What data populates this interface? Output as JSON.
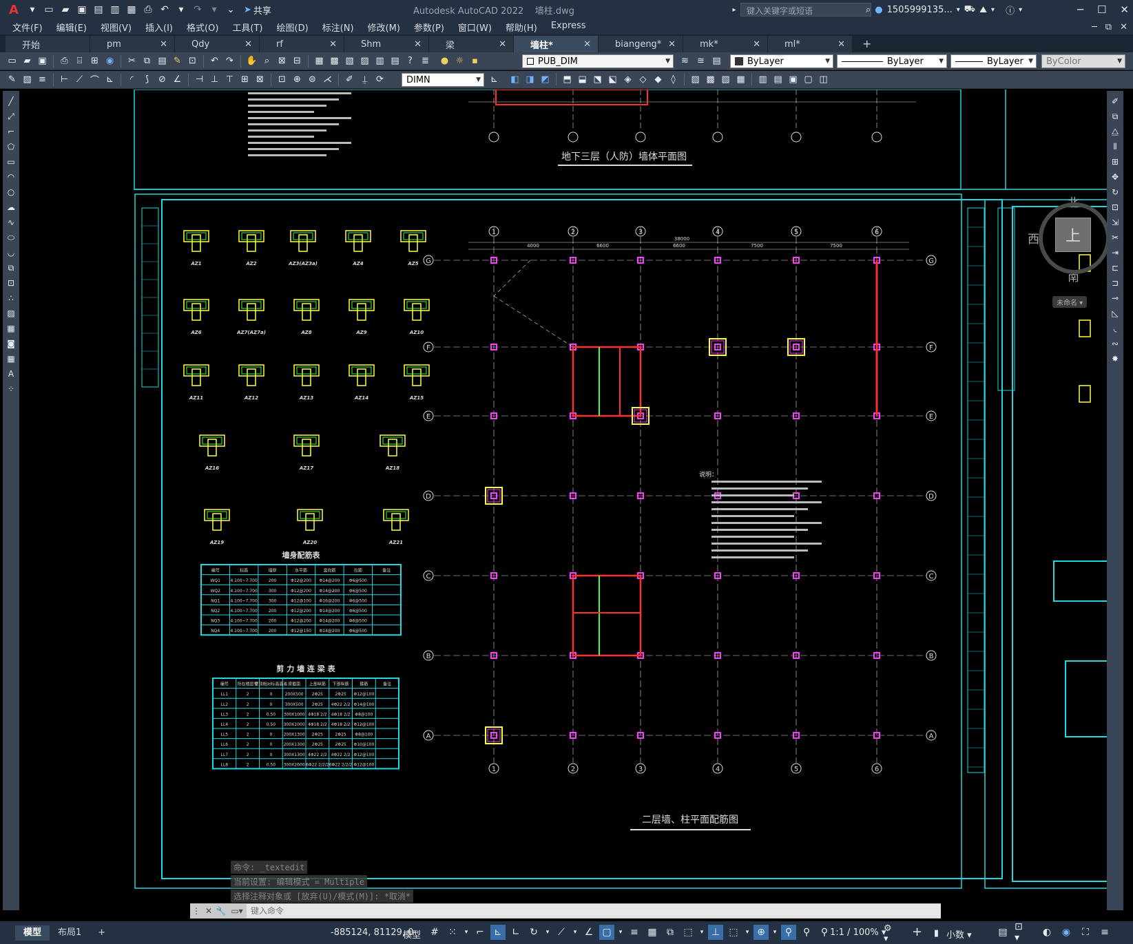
{
  "app": {
    "title": "Autodesk AutoCAD 2022",
    "file_name": "墙柱.dwg",
    "logo": "A",
    "share_label": "共享",
    "search_placeholder": "键入关键字或短语",
    "user_name": "1505999135...",
    "window_controls": [
      "minimize-icon",
      "restore-icon",
      "close-icon"
    ]
  },
  "menu": {
    "items": [
      "文件(F)",
      "编辑(E)",
      "视图(V)",
      "插入(I)",
      "格式(O)",
      "工具(T)",
      "绘图(D)",
      "标注(N)",
      "修改(M)",
      "参数(P)",
      "窗口(W)",
      "帮助(H)",
      "Express"
    ]
  },
  "tabs": {
    "items": [
      {
        "label": "开始",
        "active": false
      },
      {
        "label": "pm",
        "active": false
      },
      {
        "label": "Qdy",
        "active": false
      },
      {
        "label": "rf",
        "active": false
      },
      {
        "label": "Shm",
        "active": false
      },
      {
        "label": "梁",
        "active": false
      },
      {
        "label": "墙柱*",
        "active": true
      },
      {
        "label": "biangeng*",
        "active": false
      },
      {
        "label": "mk*",
        "active": false
      },
      {
        "label": "ml*",
        "active": false
      }
    ],
    "add_label": "+"
  },
  "toolbar": {
    "layer_value": "PUB_DIM",
    "color_value": "ByLayer",
    "linetype_value": "ByLayer",
    "lineweight_value": "ByLayer",
    "plotstyle_value": "ByColor",
    "dimstyle_value": "DIMN"
  },
  "viewcube": {
    "north": "北",
    "south": "南",
    "east": "东",
    "west": "西",
    "top": "上",
    "ucs": "未命名"
  },
  "drawing": {
    "title_top": "地下三层（人防）墙体平面图",
    "title_main": "二层墙、柱平面配筋图",
    "table1_title": "墙身配筋表",
    "table2_title": "剪 力 墙 连 梁 表",
    "notes_title": "说明：",
    "grid_cols": [
      "1",
      "2",
      "3",
      "4",
      "5",
      "6"
    ],
    "grid_rows": [
      "G",
      "F",
      "E",
      "D",
      "C",
      "B",
      "A"
    ],
    "dims_top": [
      "4000",
      "6600",
      "6600",
      "7500",
      "7500",
      "7500"
    ],
    "dims_total": "38000",
    "wall_table": {
      "headers": [
        "编号",
        "标高",
        "墙厚",
        "水平筋",
        "竖向筋",
        "拉筋",
        "备注"
      ],
      "rows": [
        [
          "WQ1",
          "4.100~7.700",
          "200",
          "Φ12@200",
          "Φ14@200",
          "Φ6@500",
          ""
        ],
        [
          "WQ2",
          "4.100~7.700",
          "300",
          "Φ12@200",
          "Φ14@200",
          "Φ6@500",
          ""
        ],
        [
          "NQ1",
          "4.100~7.700",
          "300",
          "Φ12@100",
          "Φ16@200",
          "Φ6@500",
          ""
        ],
        [
          "NQ2",
          "4.100~7.700",
          "200",
          "Φ12@200",
          "Φ14@200",
          "Φ6@500",
          ""
        ],
        [
          "NQ3",
          "4.100~7.700",
          "200",
          "Φ12@200",
          "Φ14@200",
          "Φ6@500",
          ""
        ],
        [
          "NQ4",
          "4.100~7.700",
          "200",
          "Φ12@150",
          "Φ14@200",
          "Φ6@500",
          ""
        ]
      ]
    },
    "beam_table": {
      "headers": [
        "编号",
        "所在楼层号",
        "梁顶相对标高高差",
        "梁截面",
        "上部纵筋",
        "下部纵筋",
        "箍筋",
        "备注"
      ],
      "rows": [
        [
          "LL1",
          "2",
          "0",
          "200X500",
          "2Φ25",
          "2Φ25",
          "Φ12@100",
          ""
        ],
        [
          "LL2",
          "2",
          "0",
          "300X500",
          "2Φ25",
          "4Φ22 2/2",
          "Φ14@100",
          ""
        ],
        [
          "LL3",
          "2",
          "0.50",
          "300X1000",
          "4Φ18 2/2",
          "4Φ18 2/2",
          "Φ8@100",
          ""
        ],
        [
          "LL4",
          "2",
          "0.50",
          "300X1000",
          "4Φ18 2/2",
          "4Φ18 2/2",
          "Φ12@100",
          ""
        ],
        [
          "LL5",
          "2",
          "0",
          "200X1300",
          "2Φ25",
          "2Φ25",
          "Φ8@100",
          ""
        ],
        [
          "LL6",
          "2",
          "0",
          "200X1300",
          "2Φ25",
          "2Φ25",
          "Φ10@100",
          ""
        ],
        [
          "LL7",
          "2",
          "0",
          "300X1300",
          "4Φ22 2/2",
          "4Φ22 2/2",
          "Φ12@100",
          ""
        ],
        [
          "LL8",
          "2",
          "0.50",
          "300X2600",
          "6Φ22 2/2/2",
          "6Φ22 2/2/2",
          "Φ12@100",
          ""
        ]
      ]
    },
    "col_labels": [
      "AZ1",
      "AZ2",
      "AZ3(AZ3a)",
      "AZ4",
      "AZ5",
      "AZ6",
      "AZ7(AZ7a)",
      "AZ8",
      "AZ9",
      "AZ10",
      "AZ11",
      "AZ12",
      "AZ13",
      "AZ14",
      "AZ15",
      "AZ16",
      "AZ17",
      "AZ18",
      "AZ19",
      "AZ20",
      "AZ21"
    ]
  },
  "command": {
    "history": [
      "命令: _textedit",
      "当前设置: 编辑模式 = Multiple",
      "选择注释对象或 [放弃(U)/模式(M)]: *取消*"
    ],
    "placeholder": "键入命令"
  },
  "status": {
    "layout_tabs": [
      "模型",
      "布局1"
    ],
    "add_layout": "+",
    "coords": "-885124, 81129, 0",
    "space": "模型",
    "scale": "1:1 / 100%",
    "units": "小数"
  }
}
